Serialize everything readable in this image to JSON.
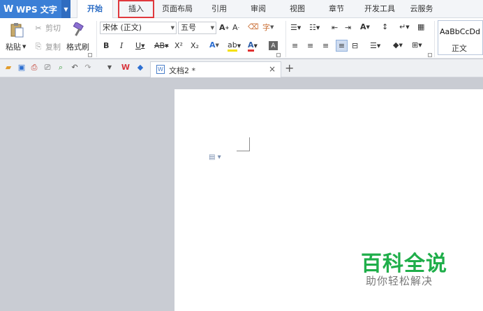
{
  "app": {
    "name": "WPS 文字",
    "logo": "W"
  },
  "tabs": [
    "开始",
    "插入",
    "页面布局",
    "引用",
    "审阅",
    "视图",
    "章节",
    "开发工具",
    "云服务"
  ],
  "ribbon": {
    "paste": "粘贴",
    "cut": "剪切",
    "copy": "复制",
    "format_painter": "格式刷",
    "font_name": "宋体 (正文)",
    "font_size": "五号",
    "bold": "B",
    "italic": "I",
    "underline": "U",
    "strikethrough": "AB",
    "superscript": "X²",
    "subscript": "X₂",
    "style_sample": "AaBbCcDd",
    "style_name": "正文"
  },
  "document_tab": {
    "title": "文档2 *",
    "close": "×",
    "new": "+"
  },
  "watermark": {
    "title": "百科全说",
    "subtitle": "助你轻松解决"
  },
  "colors": {
    "accent": "#3b7fd6",
    "highlight": "#e0393e",
    "watermark": "#1fae4a"
  }
}
